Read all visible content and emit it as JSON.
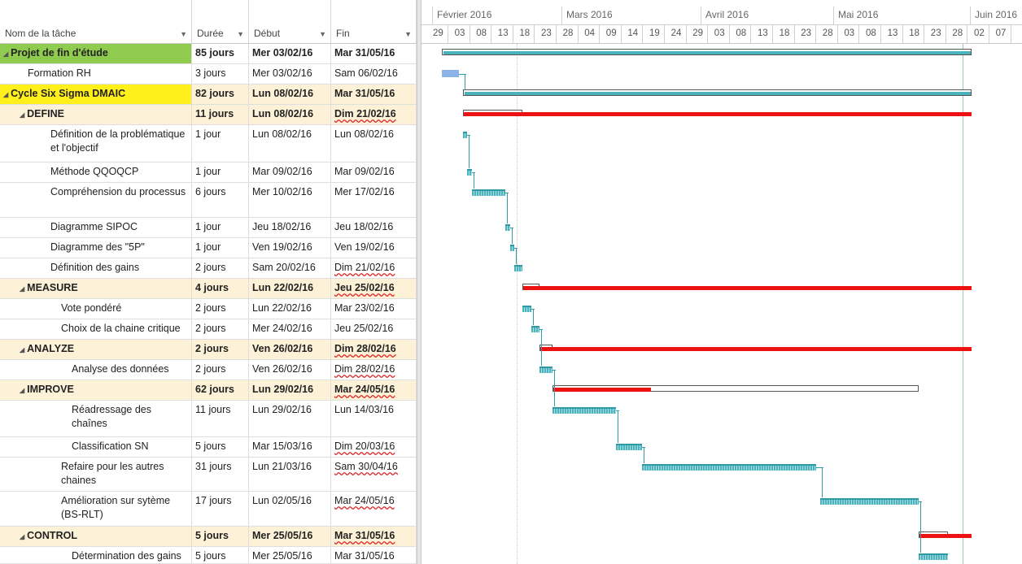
{
  "columns": {
    "name": "Nom de la tâche",
    "duration": "Durée",
    "start": "Début",
    "end": "Fin"
  },
  "timeline": {
    "months": [
      "Février 2016",
      "Mars 2016",
      "Avril 2016",
      "Mai 2016",
      "Juin 2016"
    ],
    "days": [
      "29",
      "03",
      "08",
      "13",
      "18",
      "23",
      "28",
      "04",
      "09",
      "14",
      "19",
      "24",
      "29",
      "03",
      "08",
      "13",
      "18",
      "23",
      "28",
      "03",
      "08",
      "13",
      "18",
      "23",
      "28",
      "02",
      "07"
    ]
  },
  "tasks": [
    {
      "name": "Projet de fin d'étude",
      "duration": "85 jours",
      "start": "Mer 03/02/16",
      "end": "Mar 31/05/16",
      "level": 0,
      "type": "project",
      "collapse": "◢"
    },
    {
      "name": "Formation RH",
      "duration": "3 jours",
      "start": "Mer 03/02/16",
      "end": "Sam 06/02/16",
      "level": 1,
      "type": "task"
    },
    {
      "name": "Cycle Six Sigma DMAIC",
      "duration": "82 jours",
      "start": "Lun 08/02/16",
      "end": "Mar 31/05/16",
      "level": 0,
      "type": "cycle",
      "collapse": "◢"
    },
    {
      "name": "DEFINE",
      "duration": "11 jours",
      "start": "Lun 08/02/16",
      "end": "Dim 21/02/16",
      "level": 1,
      "type": "summary",
      "collapse": "◢"
    },
    {
      "name": "Définition de la problématique et l'objectif",
      "duration": "1 jour",
      "start": "Lun 08/02/16",
      "end": "Lun 08/02/16",
      "level": 2,
      "type": "task"
    },
    {
      "name": "Méthode QQOQCP",
      "duration": "1 jour",
      "start": "Mar 09/02/16",
      "end": "Mar 09/02/16",
      "level": 2,
      "type": "task"
    },
    {
      "name": "Compréhension du processus",
      "duration": "6 jours",
      "start": "Mer 10/02/16",
      "end": "Mer 17/02/16",
      "level": 2,
      "type": "task"
    },
    {
      "name": "Diagramme SIPOC",
      "duration": "1 jour",
      "start": "Jeu 18/02/16",
      "end": "Jeu 18/02/16",
      "level": 2,
      "type": "task"
    },
    {
      "name": "Diagramme des \"5P\"",
      "duration": "1 jour",
      "start": "Ven 19/02/16",
      "end": "Ven 19/02/16",
      "level": 2,
      "type": "task"
    },
    {
      "name": "Définition des gains",
      "duration": "2 jours",
      "start": "Sam 20/02/16",
      "end": "Dim 21/02/16",
      "level": 2,
      "type": "task"
    },
    {
      "name": "MEASURE",
      "duration": "4 jours",
      "start": "Lun 22/02/16",
      "end": "Jeu 25/02/16",
      "level": 1,
      "type": "summary",
      "collapse": "◢"
    },
    {
      "name": "Vote pondéré",
      "duration": "2 jours",
      "start": "Lun 22/02/16",
      "end": "Mar 23/02/16",
      "level": 3,
      "type": "task"
    },
    {
      "name": "Choix de la chaine critique",
      "duration": "2 jours",
      "start": "Mer 24/02/16",
      "end": "Jeu 25/02/16",
      "level": 3,
      "type": "task"
    },
    {
      "name": "ANALYZE",
      "duration": "2 jours",
      "start": "Ven 26/02/16",
      "end": "Dim 28/02/16",
      "level": 1,
      "type": "summary",
      "collapse": "◢"
    },
    {
      "name": "Analyse des données",
      "duration": "2 jours",
      "start": "Ven 26/02/16",
      "end": "Dim 28/02/16",
      "level": 4,
      "type": "task"
    },
    {
      "name": "IMPROVE",
      "duration": "62 jours",
      "start": "Lun 29/02/16",
      "end": "Mar 24/05/16",
      "level": 1,
      "type": "summary",
      "collapse": "◢"
    },
    {
      "name": "Réadressage  des chaînes",
      "duration": "11 jours",
      "start": "Lun 29/02/16",
      "end": "Lun 14/03/16",
      "level": 4,
      "type": "task"
    },
    {
      "name": "Classification SN",
      "duration": "5 jours",
      "start": "Mar 15/03/16",
      "end": "Dim 20/03/16",
      "level": 4,
      "type": "task"
    },
    {
      "name": "Refaire pour les autres chaines",
      "duration": "31 jours",
      "start": "Lun 21/03/16",
      "end": "Sam 30/04/16",
      "level": 3,
      "type": "task"
    },
    {
      "name": "Amélioration sur sytème (BS-RLT)",
      "duration": "17 jours",
      "start": "Lun 02/05/16",
      "end": "Mar 24/05/16",
      "level": 3,
      "type": "task"
    },
    {
      "name": "CONTROL",
      "duration": "5 jours",
      "start": "Mer 25/05/16",
      "end": "Mar 31/05/16",
      "level": 1,
      "type": "summary",
      "collapse": "◢"
    },
    {
      "name": "Détermination des gains",
      "duration": "5 jours",
      "start": "Mer 25/05/16",
      "end": "Mar 31/05/16",
      "level": 4,
      "type": "task"
    }
  ],
  "colors": {
    "project_fill": "#8fcb4e",
    "cycle_fill": "#ffef1a",
    "summary_fill": "#fdf1d8",
    "task_bar": "#4ab3bd",
    "critical_bar": "#ee1111",
    "progress_bar": "#8cb4e8"
  }
}
